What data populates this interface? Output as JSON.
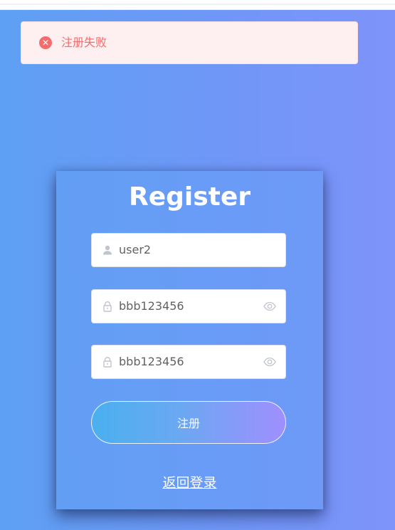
{
  "alert": {
    "icon": "close-circle-icon",
    "message": "注册失败",
    "color": "#f56c6c"
  },
  "form": {
    "title": "Register",
    "username": {
      "value": "user2",
      "icon": "user-icon"
    },
    "password": {
      "value": "bbb123456",
      "icon": "lock-icon",
      "toggle_icon": "eye-icon"
    },
    "confirm_password": {
      "value": "bbb123456",
      "icon": "lock-icon",
      "toggle_icon": "eye-icon"
    },
    "submit_label": "注册",
    "back_link_label": "返回登录"
  },
  "colors": {
    "background_start": "#5ea0f3",
    "background_end": "#7e94fb",
    "button_start": "#4ab0ef",
    "button_end": "#9f8ffe"
  }
}
